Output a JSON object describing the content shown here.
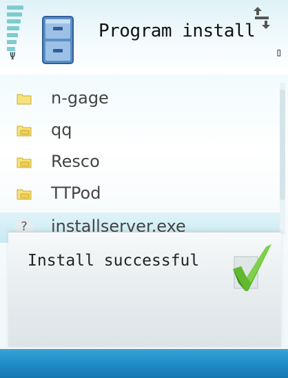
{
  "title_bar": {
    "title": "Program install",
    "app_icon": "file-cabinet-icon",
    "status_icons": [
      "signal-strength-icon",
      "antenna-icon",
      "data-transfer-icon",
      "battery-icon"
    ]
  },
  "list": {
    "items": [
      {
        "label": "n-gage",
        "icon": "folder-icon",
        "type": "folder"
      },
      {
        "label": "qq",
        "icon": "folder-icon",
        "type": "folder"
      },
      {
        "label": "Resco",
        "icon": "folder-icon",
        "type": "folder"
      },
      {
        "label": "TTPod",
        "icon": "folder-icon",
        "type": "folder"
      },
      {
        "label": "installserver.exe",
        "icon": "question-file-icon",
        "type": "file",
        "selected": true
      }
    ]
  },
  "popup": {
    "message": "Install successful",
    "icon": "checkmark-icon"
  },
  "colors": {
    "softkey_bar": "#1f8dc8",
    "highlight": "#c9e9f3",
    "check": "#5fb32a"
  }
}
